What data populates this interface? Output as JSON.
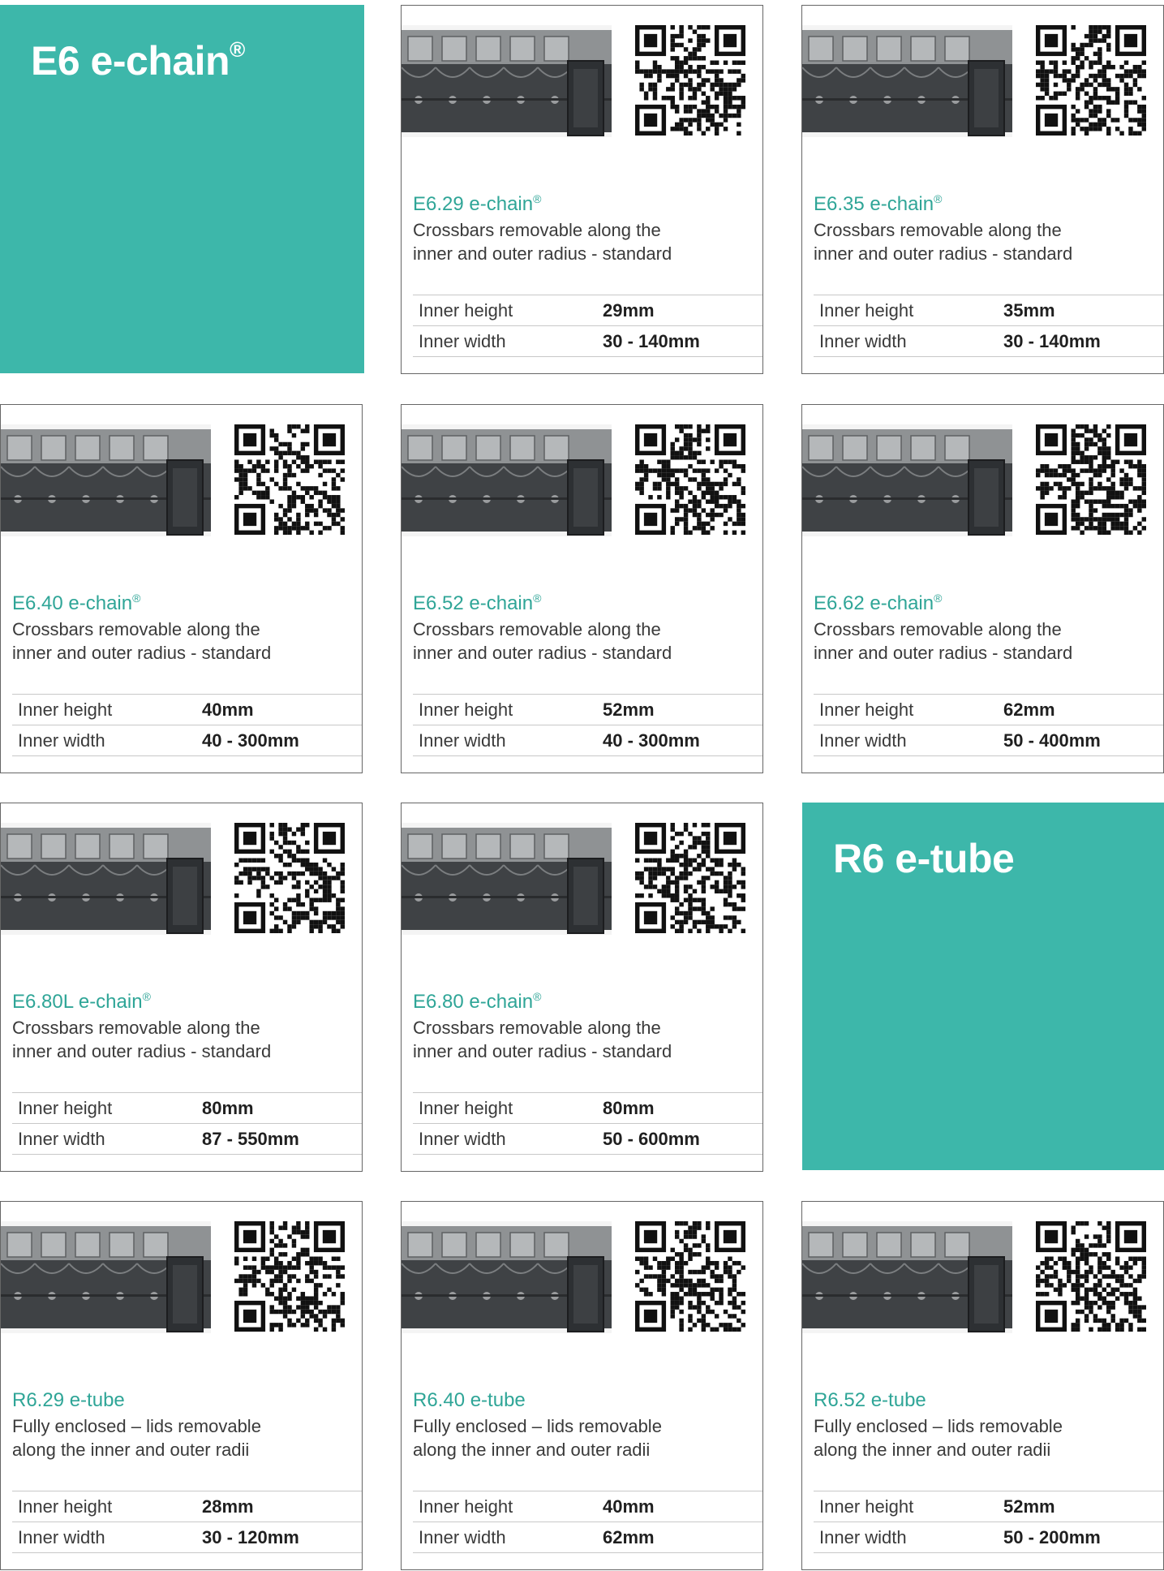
{
  "colors": {
    "accent": "#3db7aa",
    "title": "#2fa597"
  },
  "sections": [
    {
      "title": "E6 e-chain",
      "mark": "®"
    },
    {
      "title": "R6 e-tube",
      "mark": ""
    }
  ],
  "products": [
    {
      "name": "E6.29 e-chain",
      "mark": "®",
      "desc1": "Crossbars removable along the",
      "desc2": "inner and outer radius - standard",
      "height_label": "Inner height",
      "height": "29mm",
      "width_label": "Inner width",
      "width": "30 - 140mm",
      "qr_icon": "qr-code"
    },
    {
      "name": "E6.35 e-chain",
      "mark": "®",
      "desc1": "Crossbars removable along the",
      "desc2": "inner and outer radius - standard",
      "height_label": "Inner height",
      "height": "35mm",
      "width_label": "Inner width",
      "width": "30 - 140mm",
      "qr_icon": "qr-code"
    },
    {
      "name": "E6.40 e-chain",
      "mark": "®",
      "desc1": "Crossbars removable along the",
      "desc2": "inner and outer radius - standard",
      "height_label": "Inner height",
      "height": "40mm",
      "width_label": "Inner width",
      "width": "40 - 300mm",
      "qr_icon": "qr-code"
    },
    {
      "name": "E6.52 e-chain",
      "mark": "®",
      "desc1": "Crossbars removable along the",
      "desc2": "inner and outer radius - standard",
      "height_label": "Inner height",
      "height": "52mm",
      "width_label": "Inner width",
      "width": "40 - 300mm",
      "qr_icon": "qr-code"
    },
    {
      "name": "E6.62 e-chain",
      "mark": "®",
      "desc1": "Crossbars removable along the",
      "desc2": "inner and outer radius - standard",
      "height_label": "Inner height",
      "height": "62mm",
      "width_label": "Inner width",
      "width": "50 - 400mm",
      "qr_icon": "qr-code"
    },
    {
      "name": "E6.80L e-chain",
      "mark": "®",
      "desc1": "Crossbars removable along the",
      "desc2": "inner and outer radius - standard",
      "height_label": "Inner height",
      "height": "80mm",
      "width_label": "Inner width",
      "width": "87 - 550mm",
      "qr_icon": "qr-code"
    },
    {
      "name": "E6.80 e-chain",
      "mark": "®",
      "desc1": "Crossbars removable along the",
      "desc2": "inner and outer radius - standard",
      "height_label": "Inner height",
      "height": "80mm",
      "width_label": "Inner width",
      "width": "50 - 600mm",
      "qr_icon": "qr-code"
    },
    {
      "name": "R6.29 e-tube",
      "mark": "",
      "desc1": "Fully enclosed – lids removable",
      "desc2": "along the inner and outer radii",
      "height_label": "Inner height",
      "height": "28mm",
      "width_label": "Inner width",
      "width": "30 - 120mm",
      "qr_icon": "qr-code"
    },
    {
      "name": "R6.40 e-tube",
      "mark": "",
      "desc1": "Fully enclosed – lids removable",
      "desc2": "along the inner and outer radii",
      "height_label": "Inner height",
      "height": "40mm",
      "width_label": "Inner width",
      "width": "62mm",
      "qr_icon": "qr-code"
    },
    {
      "name": "R6.52 e-tube",
      "mark": "",
      "desc1": "Fully enclosed – lids removable",
      "desc2": "along the inner and outer radii",
      "height_label": "Inner height",
      "height": "52mm",
      "width_label": "Inner width",
      "width": "50 - 200mm",
      "qr_icon": "qr-code"
    }
  ]
}
